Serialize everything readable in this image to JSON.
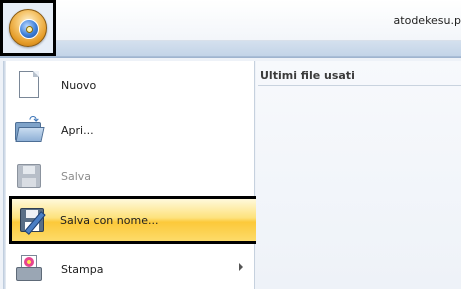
{
  "window": {
    "title": "atodekesu.p"
  },
  "app_button": {
    "icon": "app-orb-icon"
  },
  "menu": {
    "items": [
      {
        "label": "Nuovo",
        "icon": "new-document-icon",
        "enabled": true
      },
      {
        "label": "Apri...",
        "icon": "open-folder-icon",
        "enabled": true
      },
      {
        "label": "Salva",
        "icon": "save-disk-icon",
        "enabled": false
      },
      {
        "label": "Salva con nome...",
        "icon": "save-as-icon",
        "enabled": true,
        "highlighted": true
      },
      {
        "label": "Stampa",
        "icon": "print-icon",
        "enabled": true,
        "has_submenu": true
      }
    ]
  },
  "recent": {
    "title": "Ultimi file usati"
  },
  "colors": {
    "highlight": "#fcc93a",
    "accent": "#3a74b8"
  }
}
